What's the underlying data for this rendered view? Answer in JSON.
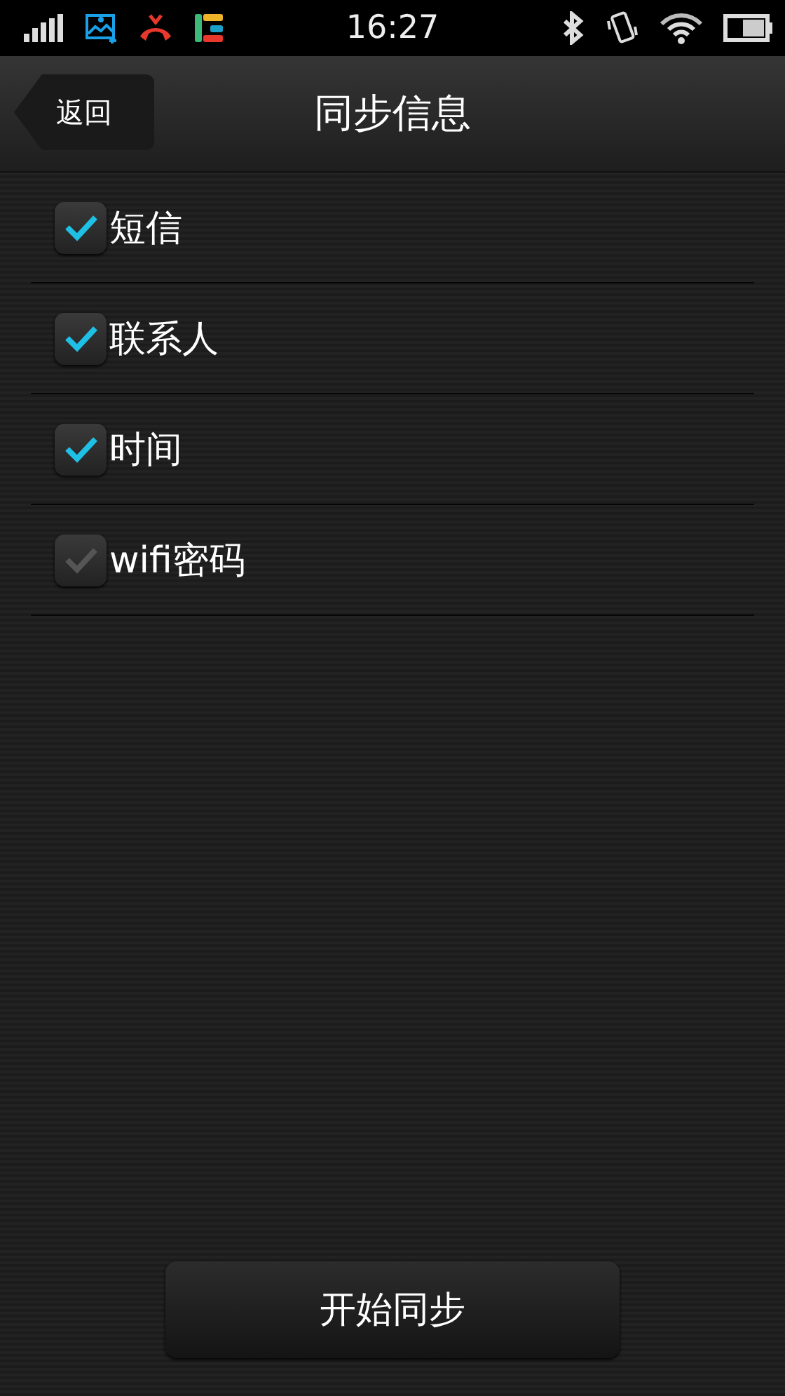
{
  "status_bar": {
    "time": "16:27"
  },
  "header": {
    "back_button": "返回",
    "title": "同步信息"
  },
  "options": [
    {
      "label": "短信",
      "checked": true
    },
    {
      "label": "联系人",
      "checked": true
    },
    {
      "label": "时间",
      "checked": true
    },
    {
      "label": "wifi密码",
      "checked": false
    }
  ],
  "start_button": "开始同步"
}
